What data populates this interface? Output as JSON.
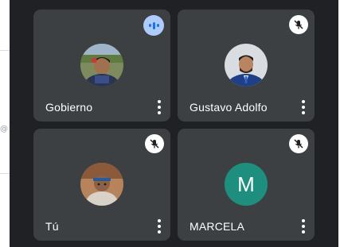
{
  "participants": [
    {
      "name": "Gobierno",
      "muted": false,
      "speaking": true,
      "avatar_icon": "photo-avatar"
    },
    {
      "name": "Gustavo Adolfo",
      "muted": true,
      "speaking": false,
      "avatar_icon": "photo-avatar"
    },
    {
      "name": "Tú",
      "muted": true,
      "speaking": false,
      "avatar_icon": "photo-avatar"
    },
    {
      "name": "MARCELA",
      "muted": true,
      "speaking": false,
      "avatar_letter": "M",
      "avatar_color": "#1e8e7e"
    }
  ],
  "sidebar": {
    "symbol": "@"
  },
  "colors": {
    "background": "#202124",
    "tile": "#3c4043",
    "speaking_badge": "#aecbfa",
    "speaking_accent": "#1a73e8"
  }
}
